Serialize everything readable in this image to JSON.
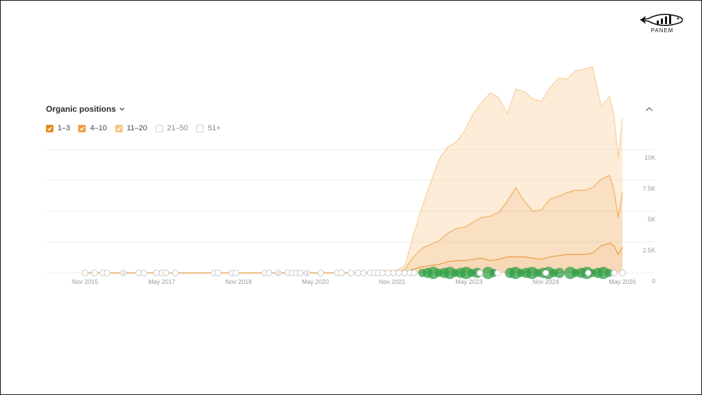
{
  "brand": {
    "name": "PANEM"
  },
  "panel": {
    "title": "Organic positions"
  },
  "legend": [
    {
      "label": "1–3",
      "checked": true,
      "color": "#e58a1f"
    },
    {
      "label": "4–10",
      "checked": true,
      "color": "#f0a040"
    },
    {
      "label": "11–20",
      "checked": true,
      "color": "#f7c485"
    },
    {
      "label": "21–50",
      "checked": false,
      "color": "#cccccc"
    },
    {
      "label": "51+",
      "checked": false,
      "color": "#cccccc"
    }
  ],
  "chart_data": {
    "type": "area",
    "stacked": true,
    "title": "Organic positions",
    "x_ticks": [
      "Nov 2015",
      "May 2017",
      "Nov 2018",
      "May 2020",
      "Nov 2021",
      "May 2023",
      "Nov 2024",
      "May 2026"
    ],
    "y_ticks": [
      "10K",
      "7.5K",
      "5K",
      "2.5K",
      "0"
    ],
    "ylim": [
      0,
      10000
    ],
    "y_axis_side": "right",
    "grid": true,
    "x": [
      "2021-09",
      "2021-12",
      "2022-02",
      "2022-04",
      "2022-06",
      "2022-08",
      "2022-10",
      "2022-12",
      "2023-02",
      "2023-04",
      "2023-06",
      "2023-08",
      "2023-10",
      "2023-12",
      "2024-02",
      "2024-04",
      "2024-06",
      "2024-08",
      "2024-10",
      "2024-12",
      "2025-02",
      "2025-04",
      "2025-06",
      "2025-08",
      "2025-10",
      "2025-12",
      "2026-02",
      "2026-03",
      "2026-04",
      "2026-05"
    ],
    "series": [
      {
        "name": "1–3",
        "color": "#e58a1f",
        "values": [
          0,
          0,
          100,
          300,
          500,
          600,
          700,
          900,
          1000,
          1000,
          1100,
          1200,
          1000,
          1100,
          1300,
          1300,
          1300,
          1200,
          1100,
          1300,
          1400,
          1500,
          1500,
          1500,
          1600,
          2200,
          2400,
          2200,
          1500,
          2100
        ]
      },
      {
        "name": "4–10",
        "color": "#f0a040",
        "values": [
          0,
          0,
          200,
          1000,
          1500,
          1700,
          1900,
          2300,
          2600,
          2700,
          3000,
          3300,
          3600,
          3800,
          4500,
          5600,
          4500,
          3800,
          4000,
          4700,
          4800,
          5000,
          5200,
          5200,
          5300,
          5400,
          5500,
          4500,
          3000,
          4500
        ]
      },
      {
        "name": "11–20",
        "color": "#f7c485",
        "values": [
          200,
          200,
          300,
          1800,
          3300,
          5000,
          6600,
          7000,
          7000,
          7800,
          8800,
          9300,
          10000,
          9300,
          7100,
          8000,
          8900,
          9100,
          8800,
          9000,
          9600,
          9200,
          9700,
          9800,
          9800,
          5900,
          6400,
          6100,
          4800,
          6000
        ]
      }
    ],
    "annotations": [
      "G",
      "2",
      "G",
      "G",
      "G",
      "2"
    ]
  }
}
